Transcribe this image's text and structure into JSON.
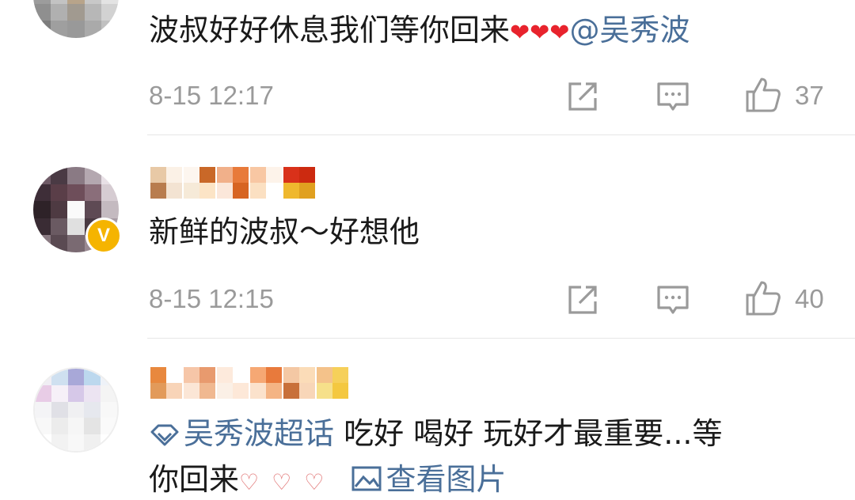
{
  "comments": [
    {
      "text": "波叔好好休息我们等你回来",
      "hearts": [
        "❤",
        "❤",
        "❤"
      ],
      "mention": "@吴秀波",
      "time": "8-15 12:17",
      "likes": "37"
    },
    {
      "text": "新鲜的波叔～好想他",
      "verified_badge": "V",
      "time": "8-15 12:15",
      "likes": "40"
    },
    {
      "topic": "吴秀波超话",
      "text_line1": " 吃好 喝好 玩好才最重要...等",
      "text_line2": "你回来",
      "view_image": "查看图片"
    }
  ],
  "icons": {
    "share": "share-icon",
    "comment": "comment-icon",
    "like": "thumbs-up-icon",
    "topic": "topic-diamond-icon",
    "image": "image-icon",
    "finger_heart": "finger-heart-emoji"
  },
  "colors": {
    "link": "#4a6f99",
    "meta": "#9a9a9a",
    "heart": "#e8232d",
    "badge": "#f5b400"
  }
}
